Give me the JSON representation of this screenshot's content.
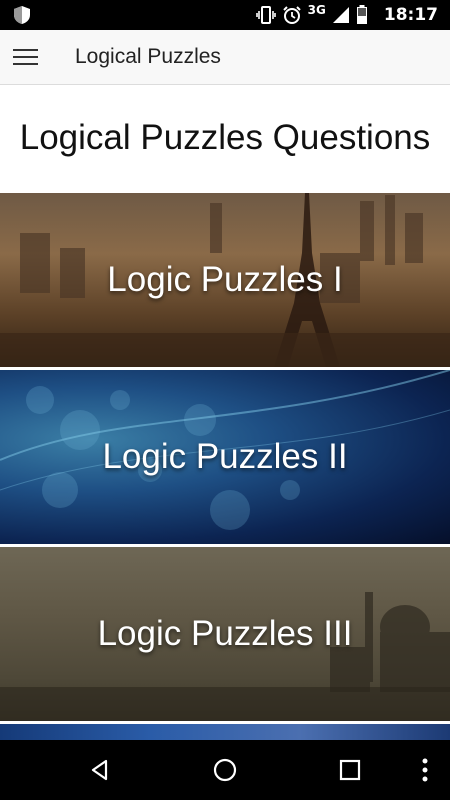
{
  "status_bar": {
    "network": "3G",
    "time": "18:17",
    "icons": [
      "shield-icon",
      "vibrate-icon",
      "alarm-icon",
      "signal-icon",
      "battery-icon"
    ]
  },
  "app_bar": {
    "title": "Logical Puzzles",
    "menu_icon": "hamburger-menu-icon"
  },
  "main": {
    "heading": "Logical Puzzles Questions",
    "cards": [
      {
        "label": "Logic Puzzles I",
        "background": "paris-eiffel-tower"
      },
      {
        "label": "Logic Puzzles II",
        "background": "blue-bokeh"
      },
      {
        "label": "Logic Puzzles III",
        "background": "desert-palace"
      },
      {
        "label": "",
        "background": "blue-castle"
      }
    ]
  },
  "nav_bar": {
    "icons": [
      "back-icon",
      "home-icon",
      "recents-icon",
      "more-options-icon"
    ]
  }
}
